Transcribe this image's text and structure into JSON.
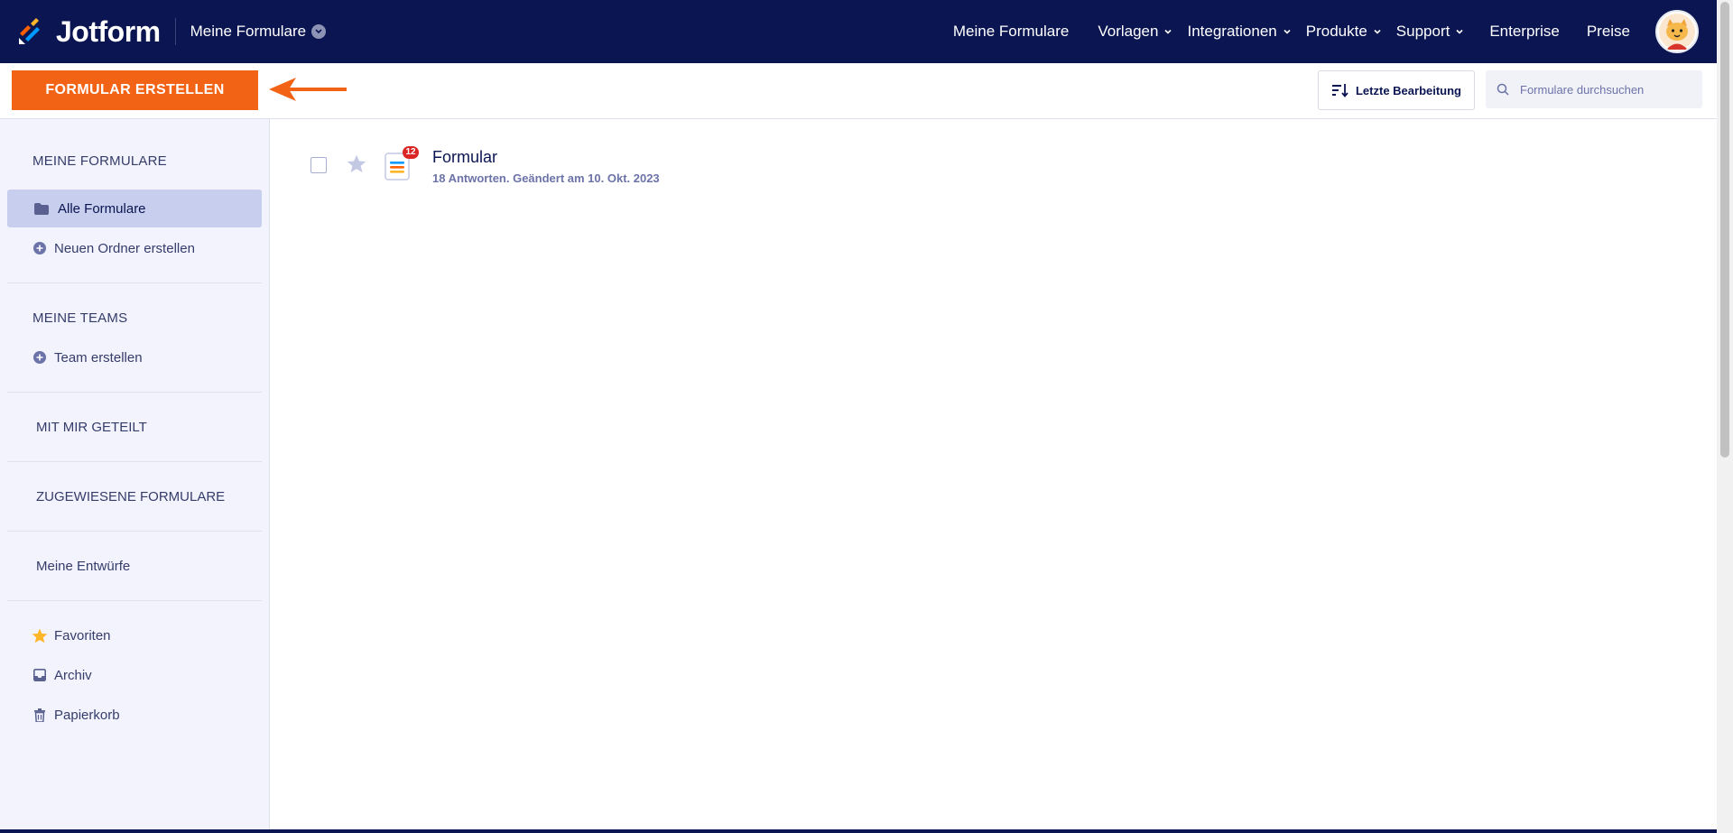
{
  "app": {
    "logo_text": "Jotform",
    "brand_color": "#0a1551",
    "accent_color": "#f26316"
  },
  "header": {
    "workspace_switch": "Meine Formulare",
    "nav": [
      {
        "label": "Meine Formulare",
        "dropdown": false
      },
      {
        "label": "Vorlagen",
        "dropdown": true
      },
      {
        "label": "Integrationen",
        "dropdown": true
      },
      {
        "label": "Produkte",
        "dropdown": true
      },
      {
        "label": "Support",
        "dropdown": true
      },
      {
        "label": "Enterprise",
        "dropdown": false
      },
      {
        "label": "Preise",
        "dropdown": false
      }
    ],
    "avatar_icon": "user-avatar-icon"
  },
  "toolbar": {
    "create_label": "FORMULAR ERSTELLEN",
    "sort_label": "Letzte Bearbeitung",
    "search_placeholder": "Formulare durchsuchen",
    "search_value": ""
  },
  "sidebar": {
    "my_forms_title": "MEINE FORMULARE",
    "all_forms": "Alle Formulare",
    "new_folder": "Neuen Ordner erstellen",
    "my_teams_title": "MEINE TEAMS",
    "create_team": "Team erstellen",
    "shared_title": "MIT MIR GETEILT",
    "assigned_title": "ZUGEWIESENE FORMULARE",
    "drafts": "Meine Entwürfe",
    "favorites": "Favoriten",
    "archive": "Archiv",
    "trash": "Papierkorb"
  },
  "forms": [
    {
      "title": "Formular",
      "meta": "18 Antworten. Geändert am 10. Okt. 2023",
      "badge": "12"
    }
  ]
}
